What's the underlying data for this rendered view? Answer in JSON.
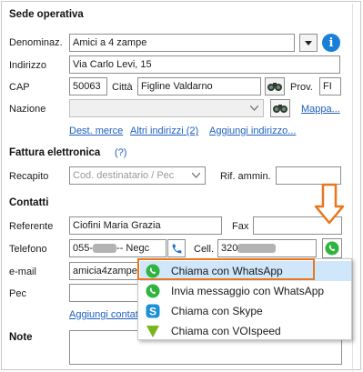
{
  "sede": {
    "title": "Sede operativa",
    "denominaz_label": "Denominaz.",
    "denominaz_value": "Amici a 4 zampe",
    "indirizzo_label": "Indirizzo",
    "indirizzo_value": "Via Carlo Levi, 15",
    "cap_label": "CAP",
    "cap_value": "50063",
    "citta_label": "Città",
    "citta_value": "Figline Valdarno",
    "prov_label": "Prov.",
    "prov_value": "FI",
    "nazione_label": "Nazione",
    "mappa_link": "Mappa...",
    "links": [
      "Dest. merce",
      "Altri indirizzi  (2)",
      "Aggiungi indirizzo..."
    ]
  },
  "fattura": {
    "title": "Fattura elettronica",
    "help": "(?)",
    "recapito_label": "Recapito",
    "recapito_placeholder": "Cod. destinatario / Pec",
    "rif_label": "Rif. ammin."
  },
  "contatti": {
    "title": "Contatti",
    "referente_label": "Referente",
    "referente_value": "Ciofini Maria Grazia",
    "fax_label": "Fax",
    "telefono_label": "Telefono",
    "telefono_prefix": "055-",
    "telefono_suffix": "-- Negc",
    "cell_label": "Cell.",
    "cell_prefix": "320",
    "email_label": "e-mail",
    "email_value": "amicia4zampe@",
    "pec_label": "Pec",
    "aggiungi_link": "Aggiungi contatt"
  },
  "note": {
    "title": "Note"
  },
  "menu": {
    "items": [
      {
        "label": "Chiama con WhatsApp",
        "icon": "whatsapp-icon"
      },
      {
        "label": "Invia messaggio con WhatsApp",
        "icon": "whatsapp-icon"
      },
      {
        "label": "Chiama con Skype",
        "icon": "skype-icon"
      },
      {
        "label": "Chiama con VOIspeed",
        "icon": "voispeed-icon"
      }
    ]
  },
  "colors": {
    "whatsapp": "#2fb440",
    "skype": "#1d8fd6",
    "voispeed": "#7ab51d",
    "highlight": "#e8771f",
    "link": "#1f5fbf",
    "info": "#1a7fd8"
  }
}
